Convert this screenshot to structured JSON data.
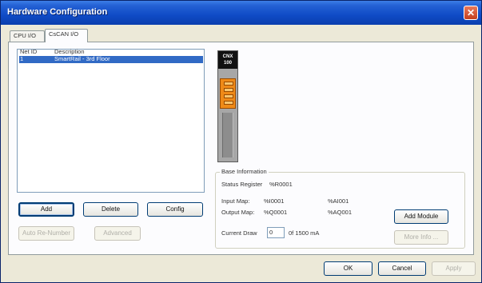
{
  "window": {
    "title": "Hardware Configuration"
  },
  "tabs": [
    {
      "label": "CPU I/O",
      "active": false
    },
    {
      "label": "CsCAN I/O",
      "active": true
    }
  ],
  "network_list": {
    "columns": [
      "Net ID",
      "Description"
    ],
    "rows": [
      {
        "net_id": "1",
        "description": "SmartRail - 3rd Floor",
        "selected": true
      }
    ]
  },
  "list_buttons": {
    "add": "Add",
    "delete": "Delete",
    "config": "Config",
    "auto_renumber": "Auto Re-Number",
    "advanced": "Advanced"
  },
  "module": {
    "name": "CNX 100",
    "connector_color": "#ef8a18"
  },
  "base_info": {
    "title": "Base Information",
    "status_register_label": "Status Register",
    "status_register_value": "%R0001",
    "input_map_label": "Input Map:",
    "input_map_digital": "%I0001",
    "input_map_analog": "%AI001",
    "output_map_label": "Output Map:",
    "output_map_digital": "%Q0001",
    "output_map_analog": "%AQ001",
    "current_draw_label": "Current Draw",
    "current_draw_value": "0",
    "current_draw_max": "0f 1500 mA",
    "add_module_label": "Add Module",
    "more_info_label": "More Info ..."
  },
  "dialog_buttons": {
    "ok": "OK",
    "cancel": "Cancel",
    "apply": "Apply"
  },
  "colors": {
    "title_bar": "#0f4bc6",
    "selection": "#316ac5",
    "close": "#d6512c"
  }
}
